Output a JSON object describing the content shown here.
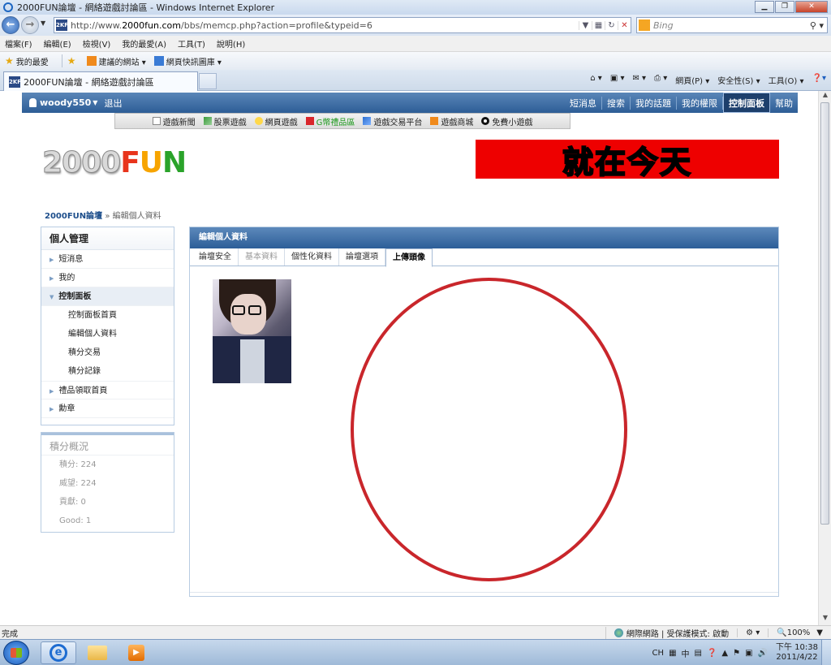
{
  "window": {
    "title": "2000FUN論壇 - 網絡遊戲討論區 - Windows Internet Explorer",
    "url_prefix": "http://www.",
    "url_domain": "2000fun.com",
    "url_path": "/bbs/memcp.php?action=profile&typeid=6",
    "search_placeholder": "Bing",
    "tab_title": "2000FUN論壇 - 網絡遊戲討論區",
    "favicon_text": "2KF"
  },
  "menubar": [
    "檔案(F)",
    "編輯(E)",
    "檢視(V)",
    "我的最愛(A)",
    "工具(T)",
    "說明(H)"
  ],
  "favbar": {
    "favorites": "我的最愛",
    "suggested": "建議的網站 ▾",
    "gallery": "網頁快訊圖庫 ▾"
  },
  "commandbar": [
    "網頁(P) ▾",
    "安全性(S) ▾",
    "工具(O) ▾"
  ],
  "site": {
    "username": "woody550",
    "logout": "退出",
    "toplinks": [
      "短消息",
      "搜索",
      "我的話題",
      "我的權限",
      "控制面板",
      "幫助"
    ],
    "active_toplink": "控制面板",
    "subnav": [
      {
        "label": "遊戲新聞",
        "color": "#333333"
      },
      {
        "label": "股票遊戲",
        "color": "#333333"
      },
      {
        "label": "網頁遊戲",
        "color": "#333333"
      },
      {
        "label": "G幣禮品區",
        "color": "#1f9a1f"
      },
      {
        "label": "遊戲交易平台",
        "color": "#333333"
      },
      {
        "label": "遊戲商城",
        "color": "#333333"
      },
      {
        "label": "免費小遊戲",
        "color": "#333333"
      }
    ],
    "logo_num": "2000",
    "logo_f": "F",
    "logo_u": "U",
    "logo_n": "N",
    "banner": "就在今天",
    "breadcrumb_home": "2000FUN論壇",
    "breadcrumb_sep": " » ",
    "breadcrumb_current": "編輯個人資料"
  },
  "sidebar": {
    "title": "個人管理",
    "items": [
      {
        "label": "短消息",
        "arrow": "▶"
      },
      {
        "label": "我的",
        "arrow": "▶"
      },
      {
        "label": "控制面板",
        "arrow": "▼"
      }
    ],
    "subitems": [
      "控制面板首頁",
      "編輯個人資料",
      "積分交易",
      "積分記錄"
    ],
    "items_after": [
      {
        "label": "禮品領取首頁",
        "arrow": "▶"
      },
      {
        "label": "勳章",
        "arrow": "▶"
      }
    ]
  },
  "credits": {
    "title": "積分概況",
    "stats": [
      "積分: 224",
      "威望: 224",
      "貢獻: 0",
      "Good: 1"
    ]
  },
  "panel": {
    "title": "編輯個人資料",
    "tabs": [
      "論壇安全",
      "基本資料",
      "個性化資料",
      "論壇選項",
      "上傳頭像"
    ],
    "active_tab": "上傳頭像"
  },
  "status": {
    "left": "完成",
    "zone": "網際網路 | 受保護模式: 啟動",
    "zoom": "100%"
  },
  "taskbar": {
    "ime": "CH",
    "ime_mode": "中",
    "time": "下午 10:38",
    "date": "2011/4/22"
  },
  "colors": {
    "accent_blue": "#2d5d96",
    "annotation_red": "#c9262b",
    "banner_red": "#ee0000"
  }
}
